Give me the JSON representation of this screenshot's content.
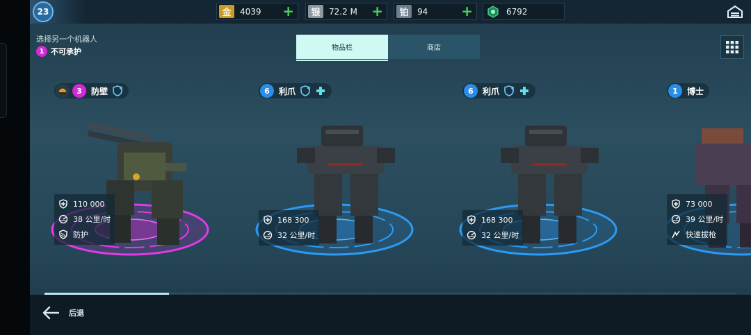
{
  "player": {
    "level": "23"
  },
  "resources": [
    {
      "icon": "gold-icon",
      "glyph": "金",
      "value": "4039",
      "has_plus": true,
      "color": "#c99a2a"
    },
    {
      "icon": "silver-icon",
      "glyph": "银",
      "value": "72.2 M",
      "has_plus": true,
      "color": "#9aa3aa"
    },
    {
      "icon": "platinum-icon",
      "glyph": "铂",
      "value": "94",
      "has_plus": true,
      "color": "#7c8a9e"
    },
    {
      "icon": "key-icon",
      "glyph": "",
      "value": "6792",
      "has_plus": false,
      "color": "#3bbf7a"
    }
  ],
  "hint": {
    "line1": "选择另一个机器人",
    "count": "1",
    "line2": "不可承护"
  },
  "tabs": {
    "inventory": "物品栏",
    "shop": "商店"
  },
  "accent": {
    "pink": "#d12ad6",
    "blue": "#2a8ee8",
    "tab_active": "#cffaf3"
  },
  "robots": [
    {
      "level": "3",
      "name": "防壁",
      "level_color": "#d12ad6",
      "platform": "pink",
      "has_pilot": true,
      "stats": [
        {
          "icon": "shield-icon",
          "text": "110 000"
        },
        {
          "icon": "speed-icon",
          "text": "38 公里/时"
        },
        {
          "icon": "ability-shield-icon",
          "text": "防护"
        }
      ]
    },
    {
      "level": "6",
      "name": "利爪",
      "level_color": "#2a8ee8",
      "platform": "blue",
      "has_pilot": false,
      "stats": [
        {
          "icon": "shield-icon",
          "text": "168 300"
        },
        {
          "icon": "speed-icon",
          "text": "32 公里/时"
        }
      ]
    },
    {
      "level": "6",
      "name": "利爪",
      "level_color": "#2a8ee8",
      "platform": "blue",
      "has_pilot": false,
      "stats": [
        {
          "icon": "shield-icon",
          "text": "168 300"
        },
        {
          "icon": "speed-icon",
          "text": "32 公里/时"
        }
      ]
    },
    {
      "level": "1",
      "name": "博士",
      "level_color": "#2a8ee8",
      "platform": "blue",
      "has_pilot": false,
      "stats": [
        {
          "icon": "shield-icon",
          "text": "73 000"
        },
        {
          "icon": "speed-icon",
          "text": "39 公里/时"
        },
        {
          "icon": "quick-draw-icon",
          "text": "快速拔枪"
        }
      ]
    }
  ],
  "scroll": {
    "position_fraction": 0.18
  },
  "footer": {
    "back_label": "后退"
  }
}
